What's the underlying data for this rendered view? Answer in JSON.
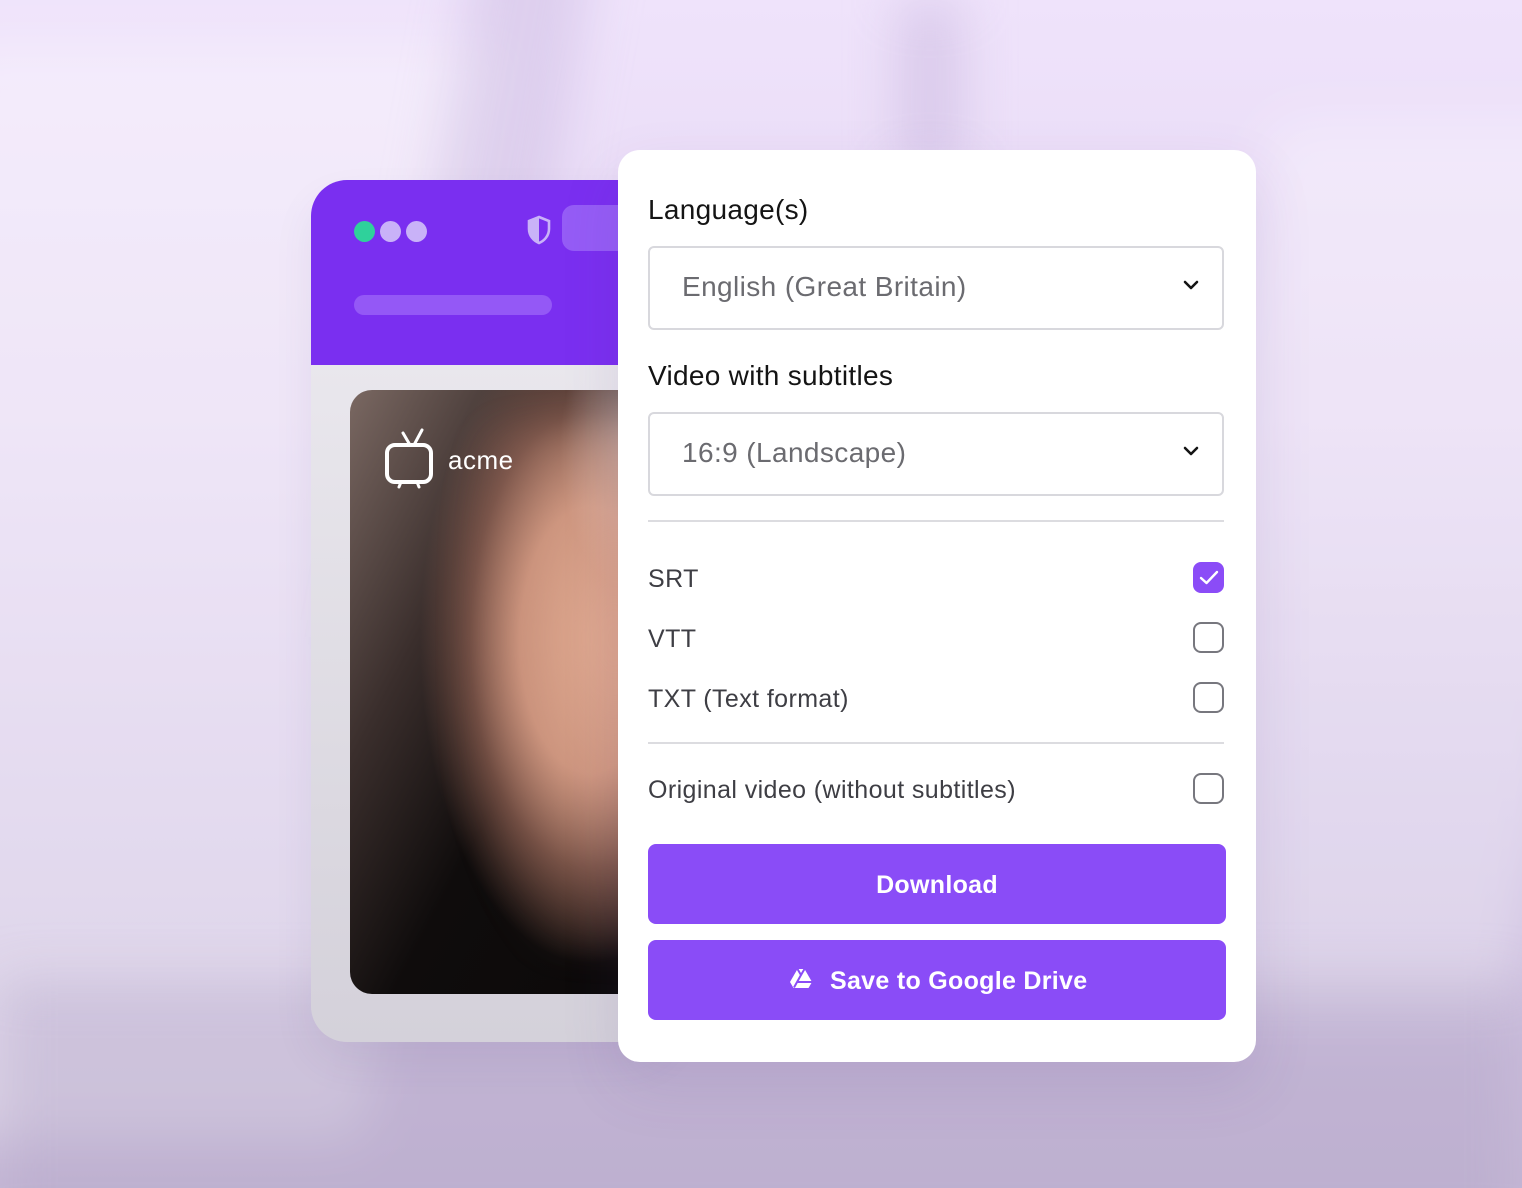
{
  "mockup": {
    "brand_name": "acme",
    "icons": [
      "shield-icon",
      "tv-icon"
    ],
    "window_dot_colors": [
      "#2fd19b",
      "#c9b2f8",
      "#c9b2f8"
    ],
    "accent_color": "#7a2ff0"
  },
  "dialog": {
    "language": {
      "title": "Language(s)",
      "selected": "English (Great Britain)",
      "icon": "chevron-down-icon"
    },
    "video": {
      "title": "Video with subtitles",
      "selected": "16:9 (Landscape)",
      "icon": "chevron-down-icon"
    },
    "formats": [
      {
        "label": "SRT",
        "checked": true
      },
      {
        "label": "VTT",
        "checked": false
      },
      {
        "label": "TXT (Text format)",
        "checked": false
      }
    ],
    "original": {
      "label": "Original video (without subtitles)",
      "checked": false
    },
    "buttons": {
      "download": "Download",
      "drive": "Save to Google Drive",
      "drive_icon": "google-drive-icon"
    },
    "colors": {
      "primary": "#8a4cf7",
      "checkbox_checked": "#8b4cf7"
    }
  }
}
